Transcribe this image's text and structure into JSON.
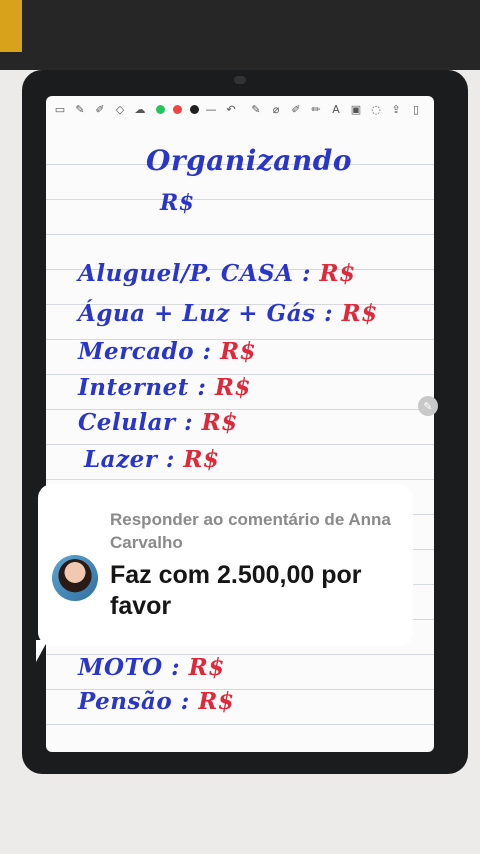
{
  "toolbar": {
    "left_icons": [
      "sidebar-icon",
      "pen-icon",
      "marker-icon",
      "eraser-icon",
      "shape-icon"
    ],
    "colors": [
      "#22c55e",
      "#ef4444",
      "#1f1f1f"
    ],
    "right_icons": [
      "pen-tool-icon",
      "brush-icon",
      "marker-tool-icon",
      "highlighter-icon",
      "text-icon",
      "image-icon",
      "lasso-icon",
      "share-icon",
      "delete-icon"
    ]
  },
  "note": {
    "title": "Organizando",
    "currency": "R$",
    "items": [
      {
        "label": "Aluguel/P. CASA :",
        "value": "R$"
      },
      {
        "label": "Água + Luz + Gás :",
        "value": "R$"
      },
      {
        "label": "Mercado :",
        "value": "R$"
      },
      {
        "label": "Internet :",
        "value": "R$"
      },
      {
        "label": "Celular :",
        "value": "R$"
      },
      {
        "label": "Lazer :",
        "value": "R$"
      },
      {
        "label": "MOTO :",
        "value": "R$"
      },
      {
        "label": "Pensão :",
        "value": "R$"
      }
    ],
    "ink_colors": {
      "blue": "#2a36c9",
      "red": "#e0283a"
    }
  },
  "comment": {
    "header": "Responder ao comentário de Anna Carvalho",
    "body": "Faz com 2.500,00 por favor"
  }
}
